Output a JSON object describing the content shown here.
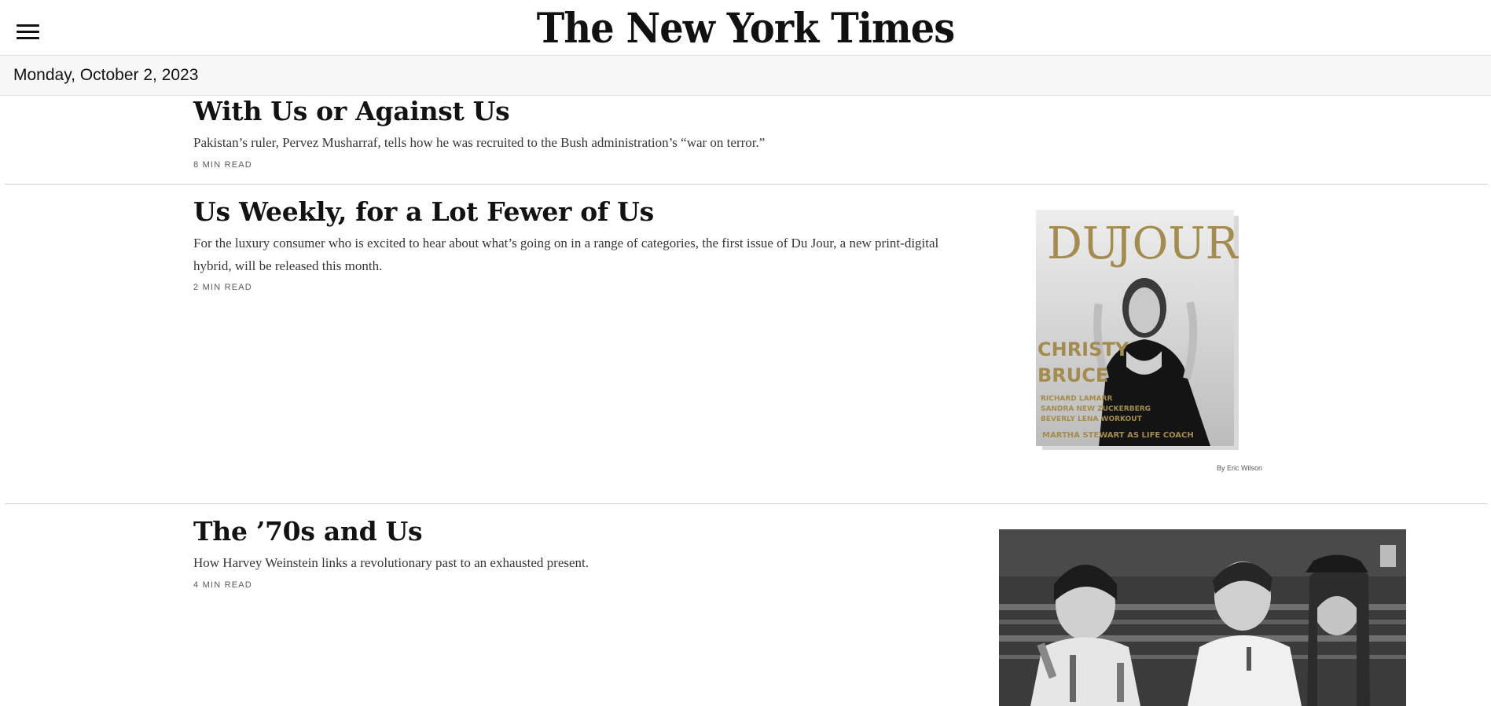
{
  "masthead": {
    "menu_icon": "hamburger-menu-icon",
    "logo_text": "The New York Times"
  },
  "date_bar": {
    "date": "Monday, October 2, 2023"
  },
  "stories": [
    {
      "headline": "With Us or Against Us",
      "summary": "Pakistan’s ruler, Pervez Musharraf, tells how he was recruited to the Bush administration’s “war on terror.”",
      "read_time": "8 MIN READ"
    },
    {
      "headline": "Us Weekly, for a Lot Fewer of Us",
      "summary": "For the luxury consumer who is excited to hear about what’s going on in a range of categories, the first issue of Du Jour, a new print-digital hybrid, will be released this month.",
      "read_time": "2 MIN READ",
      "image": {
        "masthead_text": "DU JOUR",
        "cover_lines": [
          "CHRISTY",
          "BRUCE",
          "RICHARD LAMARR",
          "SANDRA NEW ZUCKERBERG",
          "BEVERLY LENA WORKOUT",
          "MARTHA STEWART AS LIFE COACH"
        ],
        "credit": "By Eric Wilson"
      }
    },
    {
      "headline": "The ’70s and Us",
      "summary": "How Harvey Weinstein links a revolutionary past to an exhausted present.",
      "read_time": "4 MIN READ"
    }
  ],
  "colors": {
    "text": "#121212",
    "summary_text": "#363636",
    "date_bar_bg": "#f7f7f7",
    "divider": "#cfcfcf",
    "cover_gold": "#a48b4f"
  }
}
